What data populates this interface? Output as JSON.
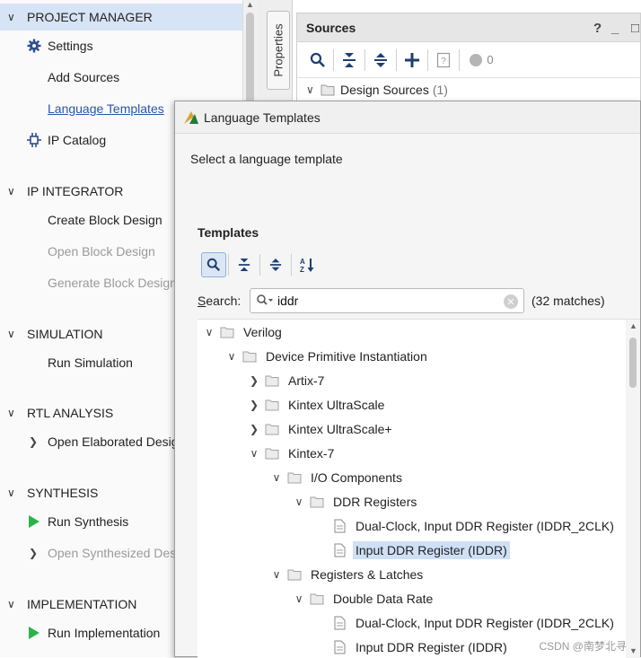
{
  "flow_navigator": {
    "project_manager": {
      "title": "PROJECT MANAGER",
      "items": {
        "settings": "Settings",
        "add_sources": "Add Sources",
        "language_templates": "Language Templates",
        "ip_catalog": "IP Catalog"
      }
    },
    "ip_integrator": {
      "title": "IP INTEGRATOR",
      "items": {
        "create_block_design": "Create Block Design",
        "open_block_design": "Open Block Design",
        "generate_block_design": "Generate Block Design"
      }
    },
    "simulation": {
      "title": "SIMULATION",
      "items": {
        "run_simulation": "Run Simulation"
      }
    },
    "rtl_analysis": {
      "title": "RTL ANALYSIS",
      "items": {
        "open_elaborated_design": "Open Elaborated Design"
      }
    },
    "synthesis": {
      "title": "SYNTHESIS",
      "items": {
        "run_synthesis": "Run Synthesis",
        "open_synthesized_design": "Open Synthesized Design"
      }
    },
    "implementation": {
      "title": "IMPLEMENTATION",
      "items": {
        "run_implementation": "Run Implementation"
      }
    }
  },
  "properties_tab": {
    "label": "Properties"
  },
  "sources_panel": {
    "title": "Sources",
    "controls": {
      "help": "?",
      "minimize": "_",
      "restore": "□"
    },
    "badge_count": "0",
    "tree": {
      "design_sources_label": "Design Sources",
      "design_sources_count": "(1)"
    }
  },
  "dialog": {
    "title": "Language Templates",
    "prompt": "Select a language template",
    "templates_label": "Templates",
    "search": {
      "label_prefix": "S",
      "label_rest": "earch:",
      "value": "iddr",
      "matches": "(32 matches)"
    },
    "tree": {
      "verilog": "Verilog",
      "device_primitive_instantiation": "Device Primitive Instantiation",
      "artix7": "Artix-7",
      "kintex_ultrascale": "Kintex UltraScale",
      "kintex_ultrascale_plus": "Kintex UltraScale+",
      "kintex7": "Kintex-7",
      "io_components": "I/O Components",
      "ddr_registers": "DDR Registers",
      "dual_clock_iddr_2clk": "Dual-Clock, Input DDR Register (IDDR_2CLK)",
      "input_ddr_iddr": "Input DDR Register (IDDR)",
      "registers_latches": "Registers & Latches",
      "double_data_rate": "Double Data Rate",
      "dual_clock_iddr_2clk_2": "Dual-Clock, Input DDR Register (IDDR_2CLK)",
      "input_ddr_iddr_2": "Input DDR Register (IDDR)"
    }
  },
  "watermark": "CSDN @南梦北寻",
  "colors": {
    "accent_green": "#2bb34a",
    "selection_blue": "#cfe0f5",
    "header_blue": "#d6e4f5",
    "link_blue": "#2a55a8"
  }
}
